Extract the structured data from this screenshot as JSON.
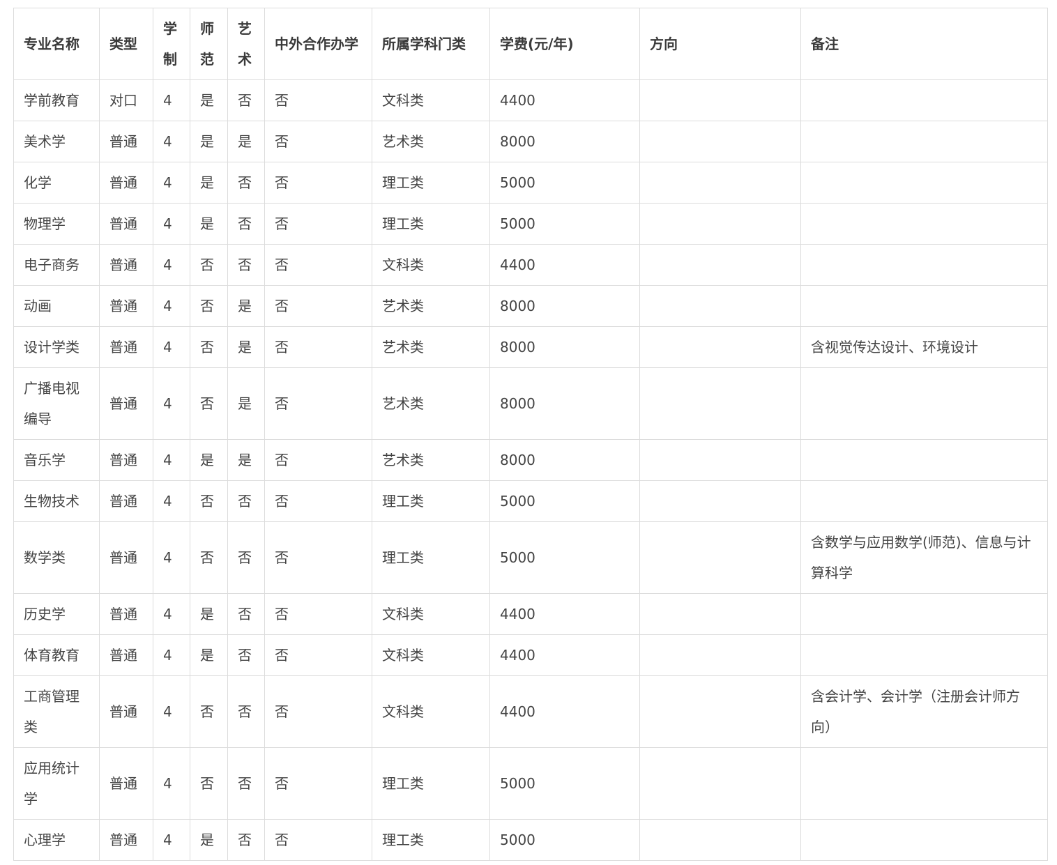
{
  "table": {
    "headers": [
      "专业名称",
      "类型",
      "学制",
      "师范",
      "艺术",
      "中外合作办学",
      "所属学科门类",
      "学费(元/年)",
      "方向",
      "备注"
    ],
    "rows": [
      [
        "学前教育",
        "对口",
        "4",
        "是",
        "否",
        "否",
        "文科类",
        "4400",
        "",
        ""
      ],
      [
        "美术学",
        "普通",
        "4",
        "是",
        "是",
        "否",
        "艺术类",
        "8000",
        "",
        ""
      ],
      [
        "化学",
        "普通",
        "4",
        "是",
        "否",
        "否",
        "理工类",
        "5000",
        "",
        ""
      ],
      [
        "物理学",
        "普通",
        "4",
        "是",
        "否",
        "否",
        "理工类",
        "5000",
        "",
        ""
      ],
      [
        "电子商务",
        "普通",
        "4",
        "否",
        "否",
        "否",
        "文科类",
        "4400",
        "",
        ""
      ],
      [
        "动画",
        "普通",
        "4",
        "否",
        "是",
        "否",
        "艺术类",
        "8000",
        "",
        ""
      ],
      [
        "设计学类",
        "普通",
        "4",
        "否",
        "是",
        "否",
        "艺术类",
        "8000",
        "",
        "含视觉传达设计、环境设计"
      ],
      [
        "广播电视编导",
        "普通",
        "4",
        "否",
        "是",
        "否",
        "艺术类",
        "8000",
        "",
        ""
      ],
      [
        "音乐学",
        "普通",
        "4",
        "是",
        "是",
        "否",
        "艺术类",
        "8000",
        "",
        ""
      ],
      [
        "生物技术",
        "普通",
        "4",
        "否",
        "否",
        "否",
        "理工类",
        "5000",
        "",
        ""
      ],
      [
        "数学类",
        "普通",
        "4",
        "否",
        "否",
        "否",
        "理工类",
        "5000",
        "",
        "含数学与应用数学(师范)、信息与计算科学"
      ],
      [
        "历史学",
        "普通",
        "4",
        "是",
        "否",
        "否",
        "文科类",
        "4400",
        "",
        ""
      ],
      [
        "体育教育",
        "普通",
        "4",
        "是",
        "否",
        "否",
        "文科类",
        "4400",
        "",
        ""
      ],
      [
        "工商管理类",
        "普通",
        "4",
        "否",
        "否",
        "否",
        "文科类",
        "4400",
        "",
        "含会计学、会计学（注册会计师方向）"
      ],
      [
        "应用统计学",
        "普通",
        "4",
        "否",
        "否",
        "否",
        "理工类",
        "5000",
        "",
        ""
      ],
      [
        "心理学",
        "普通",
        "4",
        "是",
        "否",
        "否",
        "理工类",
        "5000",
        "",
        ""
      ]
    ]
  }
}
